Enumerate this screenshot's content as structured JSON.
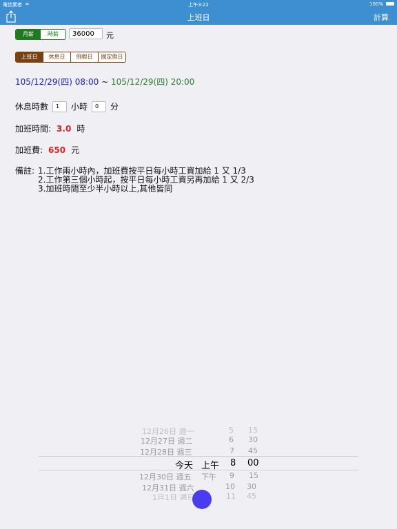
{
  "status_bar": {
    "carrier": "電信業者",
    "time": "上午3:22",
    "battery": "100%"
  },
  "navbar": {
    "title": "上班日",
    "right_button": "計算"
  },
  "pay_type": {
    "options": [
      "月薪",
      "時薪"
    ],
    "selected": "月薪"
  },
  "salary": {
    "value": "36000",
    "unit": "元"
  },
  "day_type": {
    "options": [
      "上班日",
      "休息日",
      "例假日",
      "國定假日"
    ],
    "selected": "上班日"
  },
  "time_range": {
    "start": "105/12/29(四) 08:00",
    "separator": " ~ ",
    "end": "105/12/29(四) 20:00"
  },
  "rest": {
    "label": "休息時數",
    "hours": "1",
    "hours_unit": "小時",
    "minutes": "0",
    "minutes_unit": "分"
  },
  "overtime_hours": {
    "label": "加班時間:",
    "value": "3.0",
    "unit": "時"
  },
  "overtime_pay": {
    "label": "加班費:",
    "value": "650",
    "unit": "元"
  },
  "notes": {
    "label": "備註:",
    "lines": [
      "1.工作兩小時內，加班費按平日每小時工資加給 1 又 1/3",
      "2.工作第三個小時起，按平日每小時工資另再加給 1 又 2/3",
      "3.加班時間至少半小時以上,其他皆同"
    ]
  },
  "picker": {
    "rows": [
      {
        "date": "12月26日 週一",
        "ampm": "",
        "hour": "5",
        "minute": "15"
      },
      {
        "date": "12月27日 週二",
        "ampm": "",
        "hour": "6",
        "minute": "30"
      },
      {
        "date": "12月28日 週三",
        "ampm": "",
        "hour": "7",
        "minute": "45"
      },
      {
        "date": "今天",
        "ampm": "上午",
        "hour": "8",
        "minute": "00"
      },
      {
        "date": "12月30日 週五",
        "ampm": "下午",
        "hour": "9",
        "minute": "15"
      },
      {
        "date": "12月31日 週六",
        "ampm": "",
        "hour": "10",
        "minute": "30"
      },
      {
        "date": "1月1日 週日",
        "ampm": "",
        "hour": "11",
        "minute": "45"
      }
    ]
  },
  "colors": {
    "nav": "#3d8fd1",
    "pay_seg": "#1f7a1f",
    "day_seg": "#7a4010",
    "start_time": "#1a1ad0",
    "end_time": "#2a7a2a",
    "highlight": "#e02020",
    "fab": "#4a3df0"
  }
}
